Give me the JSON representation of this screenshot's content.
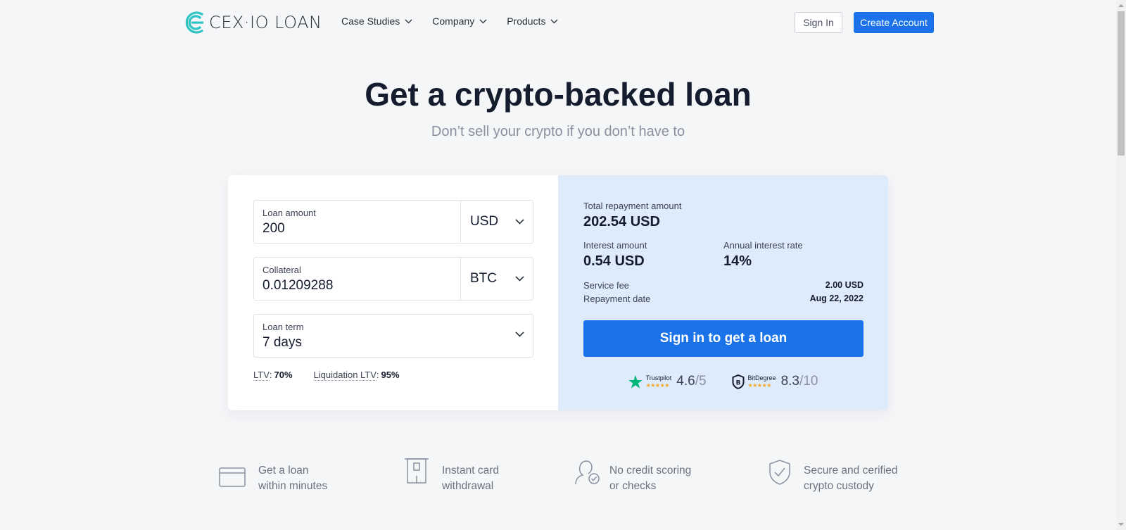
{
  "header": {
    "logo": {
      "brand": "CEX",
      "dot": "·",
      "io": "IO",
      "product": "LOAN"
    },
    "nav": [
      {
        "label": "Case Studies"
      },
      {
        "label": "Company"
      },
      {
        "label": "Products"
      }
    ],
    "sign_in": "Sign In",
    "create_account": "Create Account"
  },
  "hero": {
    "title": "Get a crypto-backed loan",
    "subtitle": "Don’t sell your crypto if you don’t have to"
  },
  "form": {
    "loan_amount": {
      "label": "Loan amount",
      "value": "200",
      "currency": "USD"
    },
    "collateral": {
      "label": "Collateral",
      "value": "0.01209288",
      "currency": "BTC"
    },
    "loan_term": {
      "label": "Loan term",
      "value": "7 days"
    },
    "ltv": {
      "label": "LTV",
      "value": "70%"
    },
    "liquidation_ltv": {
      "label": "Liquidation LTV",
      "value": "95%"
    }
  },
  "summary": {
    "total_label": "Total repayment amount",
    "total_value": "202.54 USD",
    "interest_label": "Interest amount",
    "interest_value": "0.54 USD",
    "rate_label": "Annual interest rate",
    "rate_value": "14%",
    "fee_label": "Service fee",
    "fee_value": "2.00 USD",
    "date_label": "Repayment date",
    "date_value": "Aug 22, 2022",
    "cta": "Sign in to get a loan"
  },
  "ratings": [
    {
      "name": "Trustpilot",
      "score": "4.6",
      "of": "/5",
      "stars": "★★★★★"
    },
    {
      "name": "BitDegree",
      "score": "8.3",
      "of": "/10",
      "stars": "★★★★★"
    }
  ],
  "features": [
    {
      "line1": "Get a loan",
      "line2": "within minutes",
      "icon": "card-icon"
    },
    {
      "line1": "Instant card",
      "line2": "withdrawal",
      "icon": "card-withdrawal-icon"
    },
    {
      "line1": "No credit scoring",
      "line2": "or checks",
      "icon": "user-check-icon"
    },
    {
      "line1": "Secure and cerified",
      "line2": "crypto custody",
      "icon": "shield-check-icon"
    }
  ],
  "colors": {
    "accent": "#1a73e8",
    "logo": "#2ec4c4",
    "summary_bg": "#ddebfa",
    "page_bg": "#f5f6f8"
  }
}
